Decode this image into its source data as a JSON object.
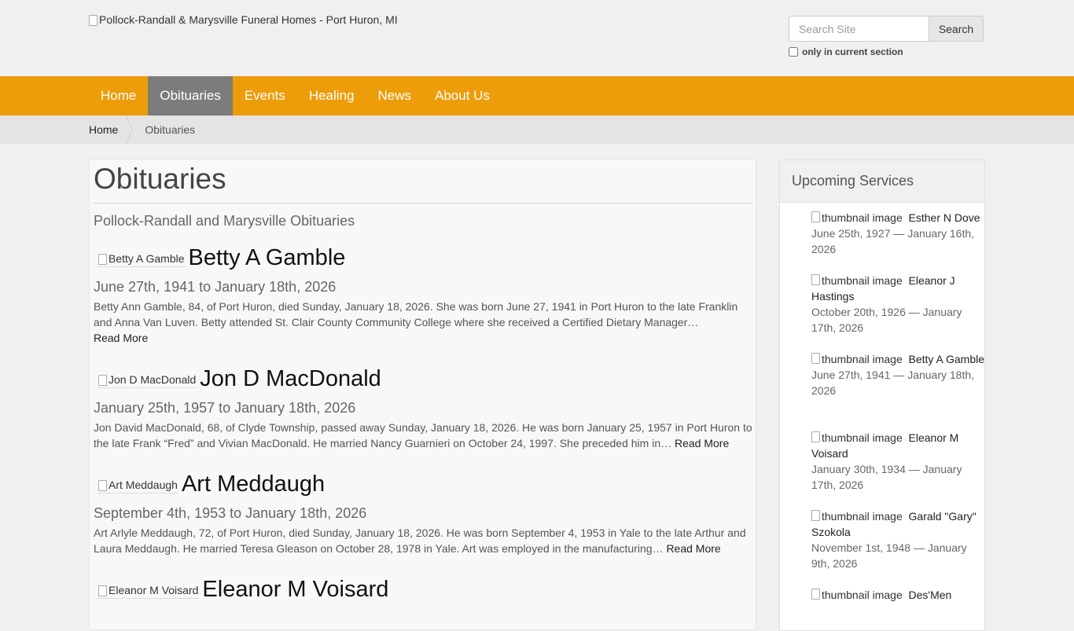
{
  "header": {
    "logo_alt": "Pollock-Randall & Marysville Funeral Homes - Port Huron, MI",
    "search_placeholder": "Search Site",
    "search_button": "Search",
    "section_only_label": "only in current section"
  },
  "nav": {
    "items": [
      "Home",
      "Obituaries",
      "Events",
      "Healing",
      "News",
      "About Us"
    ],
    "active": "Obituaries"
  },
  "breadcrumb": {
    "home": "Home",
    "current": "Obituaries"
  },
  "main": {
    "title": "Obituaries",
    "subtitle": "Pollock-Randall and Marysville Obituaries",
    "obituaries": [
      {
        "img_alt": "Betty A Gamble",
        "name": "Betty A Gamble",
        "dates": "June 27th, 1941 to January 18th, 2026",
        "text": "Betty Ann Gamble, 84, of Port Huron, died Sunday, January 18, 2026. She was born June 27, 1941 in Port Huron to the late Franklin and Anna Van Luven. Betty attended St. Clair County Community College where she received a Certified Dietary Manager…",
        "read_more": "Read More"
      },
      {
        "img_alt": "Jon D MacDonald",
        "name": "Jon D MacDonald",
        "dates": "January 25th, 1957 to January 18th, 2026",
        "text": "Jon David MacDonald, 68, of Clyde Township, passed away Sunday, January 18, 2026. He was born January 25, 1957 in Port Huron to the late Frank “Fred” and Vivian MacDonald. He married Nancy Guarnieri on October 24, 1997. She preceded him in…",
        "read_more": "Read More"
      },
      {
        "img_alt": "Art Meddaugh",
        "name": "Art Meddaugh",
        "dates": "September 4th, 1953 to January 18th, 2026",
        "text": "Art Arlyle Meddaugh, 72, of Port Huron, died Sunday, January 18, 2026. He was born September 4, 1953 in Yale to the late Arthur and Laura Meddaugh. He married Teresa Gleason on October 28, 1978 in Yale. Art was employed in the manufacturing…",
        "read_more": "Read More"
      },
      {
        "img_alt": "Eleanor M Voisard",
        "name": "Eleanor M Voisard",
        "dates": "",
        "text": "",
        "read_more": ""
      }
    ]
  },
  "sidebar": {
    "title": "Upcoming Services",
    "thumb_alt": "thumbnail image",
    "services": [
      {
        "name": "Esther N Dove",
        "dates": "June 25th, 1927 — January 16th, 2026"
      },
      {
        "name": "Eleanor J Hastings",
        "dates": "October 20th, 1926 — January 17th, 2026"
      },
      {
        "name": "Betty A Gamble",
        "dates": "June 27th, 1941 — January 18th, 2026"
      },
      {
        "name": "Eleanor M Voisard",
        "dates": "January 30th, 1934 — January 17th, 2026"
      },
      {
        "name": "Garald \"Gary\" Szokola",
        "dates": "November 1st, 1948 — January 9th, 2026"
      },
      {
        "name": "Des'Men",
        "dates": ""
      }
    ]
  }
}
